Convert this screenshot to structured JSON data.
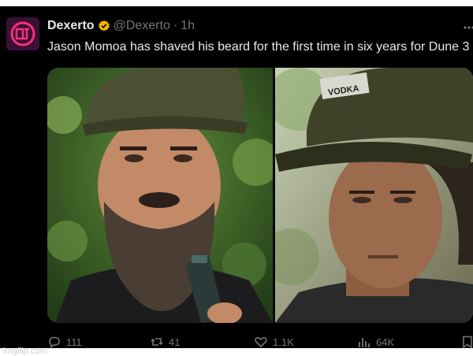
{
  "tweet": {
    "display_name": "Dexerto",
    "handle": "@Dexerto",
    "separator": "·",
    "time": "1h",
    "text": "Jason Momoa has shaved his beard for the first time in six years for Dune 3",
    "verified_icon": "verified-badge-icon",
    "verified_color": "#f5b400",
    "avatar_color": "#3a1036",
    "avatar_logo_color": "#ff2f7a",
    "text_color": "#e7e9ea",
    "muted_color": "#71767b"
  },
  "media": {
    "left_image": "bearded-man-photo",
    "left_cap_text": "",
    "right_image": "clean-shaven-man-photo",
    "right_cap_text": "VODKA"
  },
  "actions": {
    "replies": "111",
    "reposts": "41",
    "likes": "1.1K",
    "views": "64K"
  },
  "watermark": "imgflip.com"
}
